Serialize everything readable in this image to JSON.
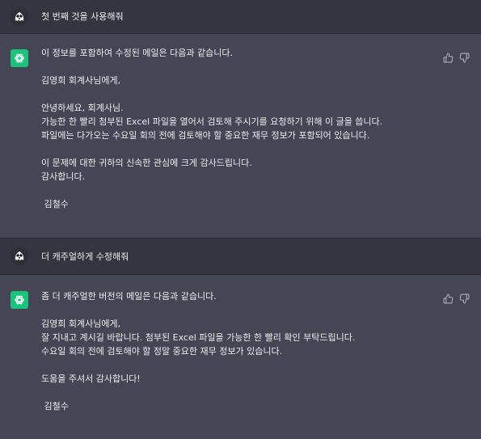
{
  "conversation": {
    "turns": [
      {
        "role": "user",
        "text": "첫 번째 것을 사용해줘"
      },
      {
        "role": "assistant",
        "lines": [
          "이 정보를 포함하여 수정된 메일은 다음과 같습니다.",
          "",
          "김영희 회계사님에게,",
          "",
          "안녕하세요, 회계사님.",
          "가능한 한 빨리 첨부된 Excel 파일을 열어서 검토해 주시기를 요청하기 위해 이 글을 씁니다.",
          "파일에는 다가오는 수요일 회의 전에 검토해야 할 중요한 재무 정보가 포함되어 있습니다.",
          "",
          "이 문제에 대한 귀하의 신속한 관심에 크게 감사드립니다.",
          "감사합니다.",
          "",
          " 김철수"
        ]
      },
      {
        "role": "user",
        "text": "더 캐주얼하게 수정해줘"
      },
      {
        "role": "assistant",
        "lines": [
          "좀 더 캐주얼한 버전의 메일은 다음과 같습니다.",
          "",
          "김영희 회계사님에게,",
          "잘 지내고 계시길 바랍니다. 첨부된 Excel 파일을 가능한 한 빨리 확인 부탁드립니다.",
          "수요일 회의 전에 검토해야 할 정말 중요한 재무 정보가 있습니다.",
          "",
          "도움을 주셔서 감사합니다!",
          "",
          " 김철수"
        ]
      }
    ]
  },
  "icons": {
    "user_avatar": "ghost-avatar-icon",
    "assistant_avatar": "openai-logo-icon",
    "thumbs_up": "thumbs-up-icon",
    "thumbs_down": "thumbs-down-icon"
  },
  "colors": {
    "user_bg": "#343541",
    "assistant_bg": "#444654",
    "assistant_avatar_bg": "#19c37d",
    "text": "#ececf1"
  }
}
